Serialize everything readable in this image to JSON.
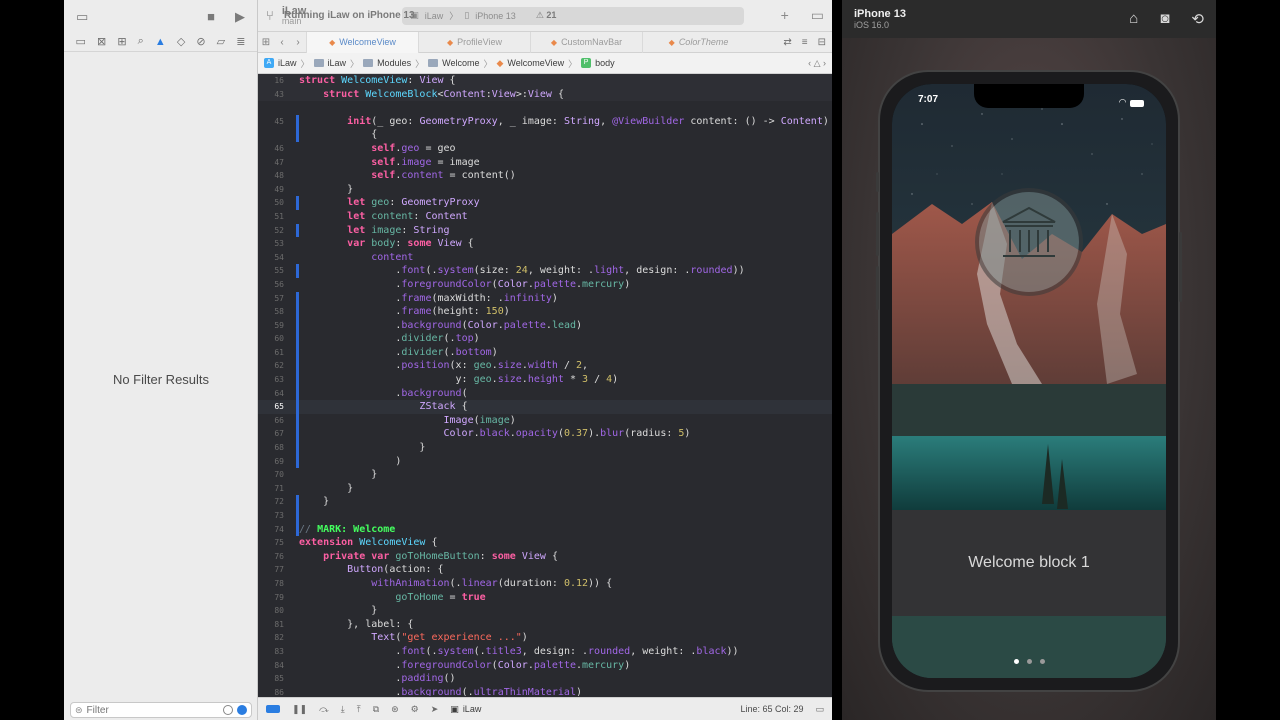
{
  "toolbar": {
    "project_name": "iLaw",
    "branch": "main",
    "scheme_app": "iLaw",
    "scheme_device": "iPhone 13",
    "run_status": "Running iLaw on iPhone 13",
    "warnings": "21"
  },
  "tabs": [
    {
      "label": "WelcomeView"
    },
    {
      "label": "ProfileView"
    },
    {
      "label": "CustomNavBar"
    },
    {
      "label": "ColorTheme"
    }
  ],
  "jumpbar": {
    "items": [
      "iLaw",
      "iLaw",
      "Modules",
      "Welcome",
      "WelcomeView",
      "body"
    ]
  },
  "navigator": {
    "empty_text": "No Filter Results",
    "filter_placeholder": "Filter"
  },
  "debugbar": {
    "scheme": "iLaw",
    "position": "Line: 65  Col: 29"
  },
  "simulator": {
    "device": "iPhone 13",
    "os": "iOS 16.0",
    "time": "7:07",
    "welcome_text": "Welcome block 1",
    "page_dots": 3,
    "active_dot": 0
  },
  "code": {
    "sticky": [
      {
        "n": "16",
        "html": "<span class='kw'>struct</span> <span class='ty'>WelcomeView</span>: <span class='tyd'>View</span> {"
      },
      {
        "n": "43",
        "html": "    <span class='kw'>struct</span> <span class='ty'>WelcomeBlock</span>&lt;<span class='tyd'>Content</span>:<span class='tyd'>View</span>&gt;:<span class='tyd'>View</span> {"
      }
    ],
    "lines": [
      {
        "n": "",
        "m": false,
        "html": ""
      },
      {
        "n": "45",
        "m": true,
        "html": "        <span class='kw'>init</span>(_ geo: <span class='tyd'>GeometryProxy</span>, _ image: <span class='tyd'>String</span>, <span class='at'>@ViewBuilder</span> content: () -&gt; <span class='tyd'>Content</span>)"
      },
      {
        "n": "",
        "m": true,
        "html": "            {"
      },
      {
        "n": "46",
        "m": false,
        "html": "            <span class='kw'>self</span>.<span class='pr'>geo</span> = geo"
      },
      {
        "n": "47",
        "m": false,
        "html": "            <span class='kw'>self</span>.<span class='pr'>image</span> = image"
      },
      {
        "n": "48",
        "m": false,
        "html": "            <span class='kw'>self</span>.<span class='pr'>content</span> = content()"
      },
      {
        "n": "49",
        "m": false,
        "html": "        }"
      },
      {
        "n": "50",
        "m": true,
        "html": "        <span class='kw'>let</span> <span class='fn'>geo</span>: <span class='tyd'>GeometryProxy</span>"
      },
      {
        "n": "51",
        "m": false,
        "html": "        <span class='kw'>let</span> <span class='fn'>content</span>: <span class='tyd'>Content</span>"
      },
      {
        "n": "52",
        "m": true,
        "html": "        <span class='kw'>let</span> <span class='fn'>image</span>: <span class='tyd'>String</span>"
      },
      {
        "n": "53",
        "m": false,
        "html": "        <span class='kw'>var</span> <span class='fn'>body</span>: <span class='kw'>some</span> <span class='tyd'>View</span> {"
      },
      {
        "n": "54",
        "m": false,
        "html": "            <span class='pr'>content</span>"
      },
      {
        "n": "55",
        "m": true,
        "html": "                .<span class='pr'>font</span>(.<span class='pr'>system</span>(size: <span class='nm'>24</span>, weight: .<span class='pr'>light</span>, design: .<span class='pr'>rounded</span>))"
      },
      {
        "n": "56",
        "m": false,
        "html": "                .<span class='pr'>foregroundColor</span>(<span class='tyd'>Color</span>.<span class='pr'>palette</span>.<span class='fn'>mercury</span>)"
      },
      {
        "n": "57",
        "m": true,
        "html": "                .<span class='pr'>frame</span>(maxWidth: .<span class='pr'>infinity</span>)"
      },
      {
        "n": "58",
        "m": true,
        "html": "                .<span class='pr'>frame</span>(height: <span class='nm'>150</span>)"
      },
      {
        "n": "59",
        "m": true,
        "html": "                .<span class='pr'>background</span>(<span class='tyd'>Color</span>.<span class='pr'>palette</span>.<span class='fn'>lead</span>)"
      },
      {
        "n": "60",
        "m": true,
        "html": "                .<span class='fn'>divider</span>(.<span class='pr'>top</span>)"
      },
      {
        "n": "61",
        "m": true,
        "html": "                .<span class='fn'>divider</span>(.<span class='pr'>bottom</span>)"
      },
      {
        "n": "62",
        "m": true,
        "html": "                .<span class='pr'>position</span>(x: <span class='fn'>geo</span>.<span class='pr'>size</span>.<span class='pr'>width</span> / <span class='nm'>2</span>,"
      },
      {
        "n": "63",
        "m": true,
        "html": "                          y: <span class='fn'>geo</span>.<span class='pr'>size</span>.<span class='pr'>height</span> * <span class='nm'>3</span> / <span class='nm'>4</span>)"
      },
      {
        "n": "64",
        "m": true,
        "html": "                .<span class='pr'>background</span>("
      },
      {
        "n": "65",
        "m": true,
        "cur": true,
        "html": "                    <span class='tyd'>ZStack</span> {"
      },
      {
        "n": "66",
        "m": true,
        "html": "                        <span class='tyd'>Image</span>(<span class='fn'>image</span>)"
      },
      {
        "n": "67",
        "m": true,
        "html": "                        <span class='tyd'>Color</span>.<span class='pr'>black</span>.<span class='pr'>opacity</span>(<span class='nm'>0.37</span>).<span class='pr'>blur</span>(radius: <span class='nm'>5</span>)"
      },
      {
        "n": "68",
        "m": true,
        "html": "                    }"
      },
      {
        "n": "69",
        "m": true,
        "html": "                )"
      },
      {
        "n": "70",
        "m": false,
        "html": "            }"
      },
      {
        "n": "71",
        "m": false,
        "html": "        }"
      },
      {
        "n": "72",
        "m": true,
        "html": "    }"
      },
      {
        "n": "73",
        "m": true,
        "html": ""
      },
      {
        "n": "74",
        "m": true,
        "html": "<span class='cm'>// </span><span class='mark'>MARK: Welcome</span>"
      },
      {
        "n": "75",
        "m": false,
        "html": "<span class='kw'>extension</span> <span class='ty'>WelcomeView</span> {"
      },
      {
        "n": "76",
        "m": false,
        "html": "    <span class='kw'>private</span> <span class='kw'>var</span> <span class='fn'>goToHomeButton</span>: <span class='kw'>some</span> <span class='tyd'>View</span> {"
      },
      {
        "n": "77",
        "m": false,
        "html": "        <span class='tyd'>Button</span>(action: {"
      },
      {
        "n": "78",
        "m": false,
        "html": "            <span class='pr'>withAnimation</span>(.<span class='pr'>linear</span>(duration: <span class='nm'>0.12</span>)) {"
      },
      {
        "n": "79",
        "m": false,
        "html": "                <span class='fn'>goToHome</span> = <span class='kw'>true</span>"
      },
      {
        "n": "80",
        "m": false,
        "html": "            }"
      },
      {
        "n": "81",
        "m": false,
        "html": "        }, label: {"
      },
      {
        "n": "82",
        "m": false,
        "html": "            <span class='tyd'>Text</span>(<span class='st'>\"get experience ...\"</span>)"
      },
      {
        "n": "83",
        "m": false,
        "html": "                .<span class='pr'>font</span>(.<span class='pr'>system</span>(.<span class='pr'>title3</span>, design: .<span class='pr'>rounded</span>, weight: .<span class='pr'>black</span>))"
      },
      {
        "n": "84",
        "m": false,
        "html": "                .<span class='pr'>foregroundColor</span>(<span class='tyd'>Color</span>.<span class='pr'>palette</span>.<span class='fn'>mercury</span>)"
      },
      {
        "n": "85",
        "m": false,
        "html": "                .<span class='pr'>padding</span>()"
      },
      {
        "n": "86",
        "m": false,
        "html": "                .<span class='pr'>background</span>(.<span class='pr'>ultraThinMaterial</span>)"
      }
    ]
  }
}
